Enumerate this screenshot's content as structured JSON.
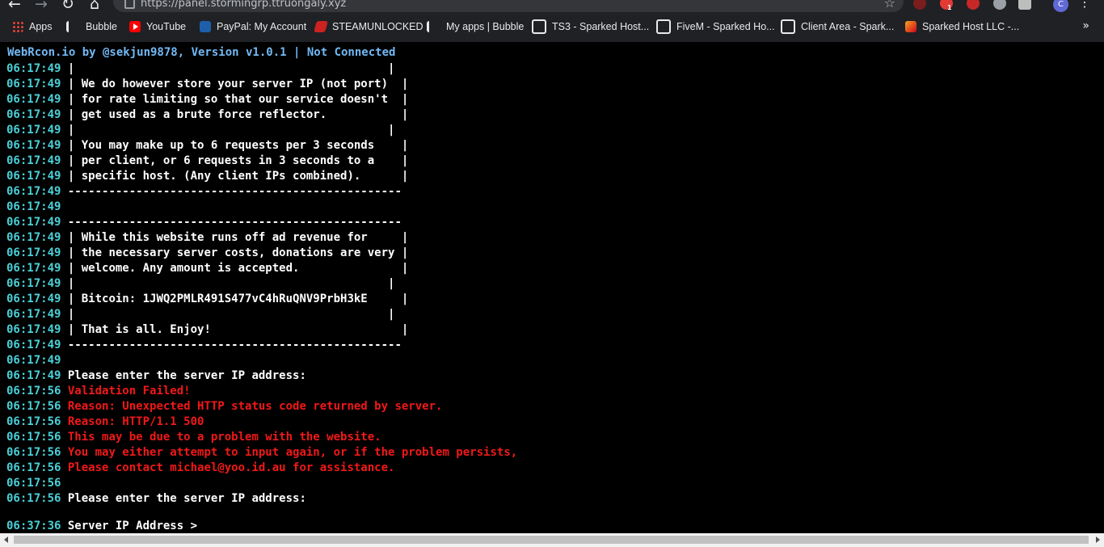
{
  "browser": {
    "url": "https://panel.stormingrp.ttruongaly.xyz",
    "profile_initial": "C",
    "ext_badge_1": "1",
    "bookmarks": [
      {
        "label": "Apps",
        "icon": "apps-grid-icon"
      },
      {
        "label": "Bubble",
        "icon": "bubble-icon"
      },
      {
        "label": "YouTube",
        "icon": "youtube-icon"
      },
      {
        "label": "PayPal: My Account",
        "icon": "paypal-icon"
      },
      {
        "label": "STEAMUNLOCKED",
        "icon": "steamunlocked-icon"
      },
      {
        "label": "My apps | Bubble",
        "icon": "bubble-icon"
      },
      {
        "label": "TS3 - Sparked Host...",
        "icon": "globe-icon"
      },
      {
        "label": "FiveM - Sparked Ho...",
        "icon": "globe-icon"
      },
      {
        "label": "Client Area - Spark...",
        "icon": "globe-icon"
      },
      {
        "label": "Sparked Host LLC -...",
        "icon": "sparked-host-icon"
      }
    ],
    "more_bookmarks": "»"
  },
  "terminal": {
    "header": "WebRcon.io by @sekjun9878, Version v1.0.1 | Not Connected",
    "lines": [
      {
        "ts": "06:17:49",
        "text": "|                                              |",
        "color": "white"
      },
      {
        "ts": "06:17:49",
        "text": "| We do however store your server IP (not port)  |",
        "color": "white"
      },
      {
        "ts": "06:17:49",
        "text": "| for rate limiting so that our service doesn't  |",
        "color": "white"
      },
      {
        "ts": "06:17:49",
        "text": "| get used as a brute force reflector.           |",
        "color": "white"
      },
      {
        "ts": "06:17:49",
        "text": "|                                              |",
        "color": "white"
      },
      {
        "ts": "06:17:49",
        "text": "| You may make up to 6 requests per 3 seconds    |",
        "color": "white"
      },
      {
        "ts": "06:17:49",
        "text": "| per client, or 6 requests in 3 seconds to a    |",
        "color": "white"
      },
      {
        "ts": "06:17:49",
        "text": "| specific host. (Any client IPs combined).      |",
        "color": "white"
      },
      {
        "ts": "06:17:49",
        "text": "-------------------------------------------------",
        "color": "white"
      },
      {
        "ts": "06:17:49",
        "text": "",
        "color": "white"
      },
      {
        "ts": "06:17:49",
        "text": "-------------------------------------------------",
        "color": "white"
      },
      {
        "ts": "06:17:49",
        "text": "| While this website runs off ad revenue for     |",
        "color": "white"
      },
      {
        "ts": "06:17:49",
        "text": "| the necessary server costs, donations are very |",
        "color": "white"
      },
      {
        "ts": "06:17:49",
        "text": "| welcome. Any amount is accepted.               |",
        "color": "white"
      },
      {
        "ts": "06:17:49",
        "text": "|                                              |",
        "color": "white"
      },
      {
        "ts": "06:17:49",
        "text": "| Bitcoin: 1JWQ2PMLR491S477vC4hRuQNV9PrbH3kE     |",
        "color": "white"
      },
      {
        "ts": "06:17:49",
        "text": "|                                              |",
        "color": "white"
      },
      {
        "ts": "06:17:49",
        "text": "| That is all. Enjoy!                            |",
        "color": "white"
      },
      {
        "ts": "06:17:49",
        "text": "-------------------------------------------------",
        "color": "white"
      },
      {
        "ts": "06:17:49",
        "text": "",
        "color": "white"
      },
      {
        "ts": "06:17:49",
        "text": "Please enter the server IP address:",
        "color": "white"
      },
      {
        "ts": "06:17:56",
        "text": "Validation Failed!",
        "color": "red"
      },
      {
        "ts": "06:17:56",
        "text": "Reason: Unexpected HTTP status code returned by server.",
        "color": "red"
      },
      {
        "ts": "06:17:56",
        "text": "Reason: HTTP/1.1 500",
        "color": "red"
      },
      {
        "ts": "06:17:56",
        "text": "This may be due to a problem with the website.",
        "color": "red"
      },
      {
        "ts": "06:17:56",
        "text": "You may either attempt to input again, or if the problem persists,",
        "color": "red"
      },
      {
        "ts": "06:17:56",
        "text": "Please contact michael@yoo.id.au for assistance.",
        "color": "red"
      },
      {
        "ts": "06:17:56",
        "text": "",
        "color": "white"
      },
      {
        "ts": "06:17:56",
        "text": "Please enter the server IP address:",
        "color": "white"
      }
    ],
    "prompt": {
      "ts": "06:37:36",
      "label": "Server IP Address >",
      "value": ""
    }
  },
  "colors": {
    "timestamp": "#4ad0d7",
    "header": "#72b9f5",
    "error": "#f11818",
    "text": "#ffffff"
  }
}
